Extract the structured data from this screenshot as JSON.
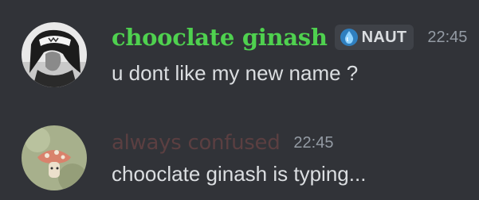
{
  "messages": [
    {
      "username": "chooclate ginash",
      "username_color": "#4fd14f",
      "tag": {
        "icon": "water-drop-icon",
        "label": "NAUT"
      },
      "timestamp": "22:45",
      "content": "u dont like my new name ?",
      "avatar": "user-avatar"
    },
    {
      "username": "always confused",
      "username_color": "#5b3f41",
      "timestamp": "22:45",
      "content": "chooclate ginash is typing...",
      "avatar": "user-avatar"
    }
  ],
  "colors": {
    "background": "#313338",
    "text": "#dbdee1",
    "muted": "#949ba4",
    "tag_bg": "#3f4248"
  }
}
